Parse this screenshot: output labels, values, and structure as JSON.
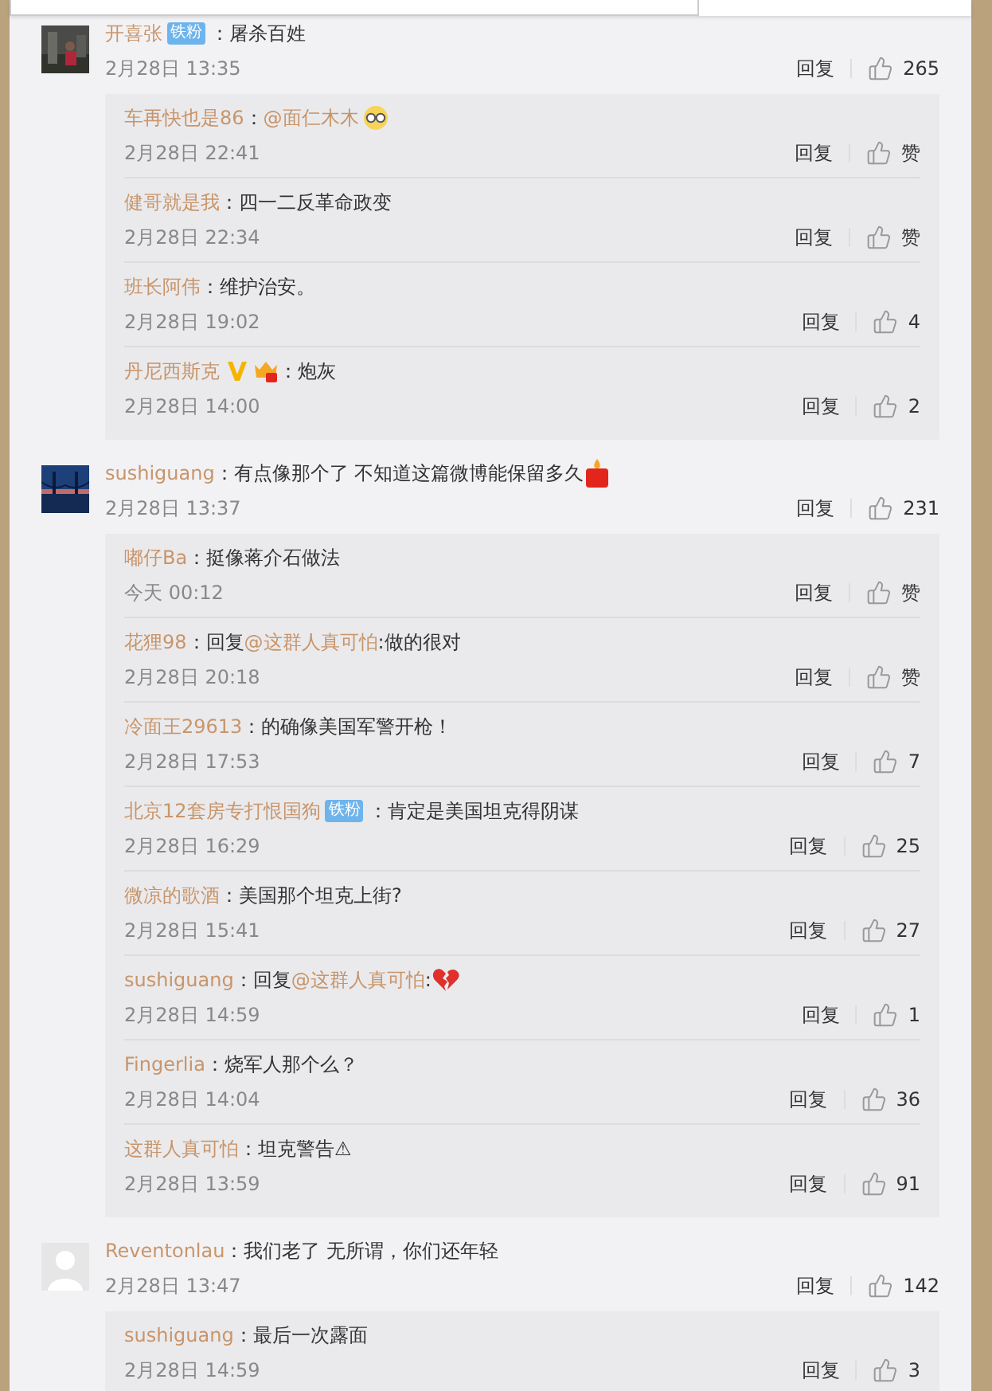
{
  "comments": [
    {
      "avatar": {
        "kind": "picture"
      },
      "author": "开喜张",
      "badges": [
        {
          "kind": "fan",
          "label": "铁粉"
        }
      ],
      "content": [
        {
          "kind": "text",
          "text": "：屠杀百姓"
        }
      ],
      "date": "2月28日 13:35",
      "reply_label": "回复",
      "likes": "265",
      "replies": [
        {
          "author": "车再快也是86",
          "content": [
            {
              "kind": "text",
              "text": "："
            },
            {
              "kind": "mention",
              "text": "@面仁木木"
            },
            {
              "kind": "glasses"
            }
          ],
          "date": "2月28日 22:41",
          "reply_label": "回复",
          "likes": "赞"
        },
        {
          "author": "健哥就是我",
          "content": [
            {
              "kind": "text",
              "text": "：四一二反革命政变"
            }
          ],
          "date": "2月28日 22:34",
          "reply_label": "回复",
          "likes": "赞"
        },
        {
          "author": "班长阿伟",
          "content": [
            {
              "kind": "text",
              "text": "：维护治安。"
            }
          ],
          "date": "2月28日 19:02",
          "reply_label": "回复",
          "likes": "4"
        },
        {
          "author": "丹尼西斯克",
          "badges": [
            {
              "kind": "verified"
            },
            {
              "kind": "crown"
            }
          ],
          "content": [
            {
              "kind": "text",
              "text": "：炮灰"
            }
          ],
          "date": "2月28日 14:00",
          "reply_label": "回复",
          "likes": "2"
        }
      ]
    },
    {
      "avatar": {
        "kind": "picture"
      },
      "author": "sushiguang",
      "content": [
        {
          "kind": "text",
          "text": "：有点像那个了 不知道这篇微博能保留多久"
        },
        {
          "kind": "candle"
        }
      ],
      "date": "2月28日 13:37",
      "reply_label": "回复",
      "likes": "231",
      "replies": [
        {
          "author": "嘟仔Ba",
          "content": [
            {
              "kind": "text",
              "text": "：挺像蒋介石做法"
            }
          ],
          "date": "今天 00:12",
          "reply_label": "回复",
          "likes": "赞"
        },
        {
          "author": "花狸98",
          "content": [
            {
              "kind": "text",
              "text": "：回复"
            },
            {
              "kind": "mention",
              "text": "@这群人真可怕"
            },
            {
              "kind": "text",
              "text": ":做的很对"
            }
          ],
          "date": "2月28日 20:18",
          "reply_label": "回复",
          "likes": "赞"
        },
        {
          "author": "冷面王29613",
          "content": [
            {
              "kind": "text",
              "text": "：的确像美国军警开枪！"
            }
          ],
          "date": "2月28日 17:53",
          "reply_label": "回复",
          "likes": "7"
        },
        {
          "author": "北京12套房专打恨国狗",
          "badges": [
            {
              "kind": "fan",
              "label": "铁粉"
            }
          ],
          "content": [
            {
              "kind": "text",
              "text": "：肯定是美国坦克得阴谋"
            }
          ],
          "date": "2月28日 16:29",
          "reply_label": "回复",
          "likes": "25"
        },
        {
          "author": "微凉的歌酒",
          "content": [
            {
              "kind": "text",
              "text": "：美国那个坦克上街?"
            }
          ],
          "date": "2月28日 15:41",
          "reply_label": "回复",
          "likes": "27"
        },
        {
          "author": "sushiguang",
          "content": [
            {
              "kind": "text",
              "text": "：回复"
            },
            {
              "kind": "mention",
              "text": "@这群人真可怕"
            },
            {
              "kind": "text",
              "text": ":"
            },
            {
              "kind": "heartbreak"
            }
          ],
          "date": "2月28日 14:59",
          "reply_label": "回复",
          "likes": "1"
        },
        {
          "author": "Fingerlia",
          "content": [
            {
              "kind": "text",
              "text": "：烧军人那个么？"
            }
          ],
          "date": "2月28日 14:04",
          "reply_label": "回复",
          "likes": "36"
        },
        {
          "author": "这群人真可怕",
          "content": [
            {
              "kind": "text",
              "text": "：坦克警告⚠"
            }
          ],
          "date": "2月28日 13:59",
          "reply_label": "回复",
          "likes": "91"
        }
      ]
    },
    {
      "avatar": {
        "kind": "default"
      },
      "author": "Reventonlau",
      "content": [
        {
          "kind": "text",
          "text": "：我们老了 无所谓，你们还年轻"
        }
      ],
      "date": "2月28日 13:47",
      "reply_label": "回复",
      "likes": "142",
      "replies": [
        {
          "author": "sushiguang",
          "content": [
            {
              "kind": "text",
              "text": "：最后一次露面"
            }
          ],
          "date": "2月28日 14:59",
          "reply_label": "回复",
          "likes": "3"
        }
      ]
    }
  ]
}
